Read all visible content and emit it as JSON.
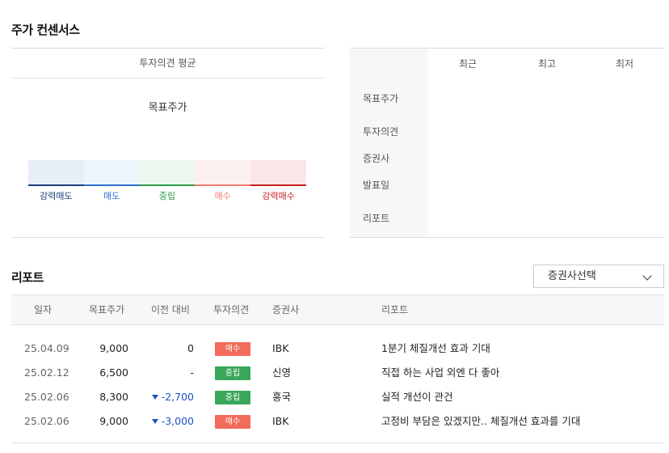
{
  "consensus": {
    "title": "주가 컨센서스",
    "avg_header": "투자의견 평균",
    "target_label": "목표주가",
    "opinions": [
      {
        "label": "강력매도",
        "color": "#1f3f7a",
        "bg": "#e8eef8"
      },
      {
        "label": "매도",
        "color": "#2f6fd0",
        "bg": "#eef4fc"
      },
      {
        "label": "중립",
        "color": "#2e9e44",
        "bg": "#eef8f0"
      },
      {
        "label": "매수",
        "color": "#f07c6c",
        "bg": "#fdf1ef"
      },
      {
        "label": "강력매수",
        "color": "#c81e1e",
        "bg": "#fbe7e7"
      }
    ],
    "columns": [
      "최근",
      "최고",
      "최저"
    ],
    "rows": [
      "목표주가",
      "투자의견",
      "증권사",
      "발표일",
      "리포트"
    ]
  },
  "reports": {
    "title": "리포트",
    "dropdown_label": "증권사선택",
    "headers": {
      "date": "일자",
      "target": "목표주가",
      "change": "이전 대비",
      "opinion": "투자의견",
      "broker": "증권사",
      "report": "리포트"
    },
    "rows": [
      {
        "date": "25.04.09",
        "target": "9,000",
        "change": "0",
        "down": false,
        "opinion": "매수",
        "opinion_color": "#f26b5b",
        "broker": "IBK",
        "report": "1분기 체질개선 효과 기대"
      },
      {
        "date": "25.02.12",
        "target": "6,500",
        "change": "-",
        "down": false,
        "opinion": "중립",
        "opinion_color": "#3aa65a",
        "broker": "신영",
        "report": "직접 하는 사업 외엔 다 좋아"
      },
      {
        "date": "25.02.06",
        "target": "8,300",
        "change": "-2,700",
        "down": true,
        "opinion": "중립",
        "opinion_color": "#3aa65a",
        "broker": "흥국",
        "report": "실적 개선이 관건"
      },
      {
        "date": "25.02.06",
        "target": "9,000",
        "change": "-3,000",
        "down": true,
        "opinion": "매수",
        "opinion_color": "#f26b5b",
        "broker": "IBK",
        "report": "고정비 부담은 있겠지만.. 체질개선 효과를 기대"
      }
    ]
  }
}
